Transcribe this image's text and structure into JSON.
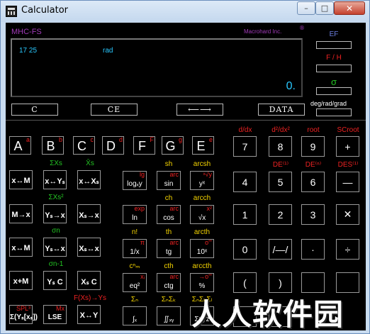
{
  "window": {
    "title": "Calculator",
    "min": "–",
    "max": "□",
    "close": "✕"
  },
  "brand": {
    "model": "MHC-FS",
    "maker": "Macrohard Inc.",
    "reg": "®"
  },
  "display": {
    "digits": "17 25",
    "mode": "rad",
    "value": "0."
  },
  "indicators": [
    {
      "label": "EF",
      "color": "#6b7fe0"
    },
    {
      "label": "F / H",
      "color": "#e22"
    },
    {
      "label": "σ",
      "color": "#23c423"
    }
  ],
  "deg_label": "deg/rad/grad",
  "top_buttons": [
    "C",
    "CE",
    "⟵⟶",
    "DATA"
  ],
  "letters": [
    {
      "main": "A",
      "sup": "a"
    },
    {
      "main": "B",
      "sup": "b"
    },
    {
      "main": "C",
      "sup": "c"
    },
    {
      "main": "D",
      "sup": "d"
    },
    {
      "main": "F",
      "sup": "F"
    },
    {
      "main": "G",
      "sup": "g"
    },
    {
      "main": "E",
      "sup": "e"
    }
  ],
  "stat_keys": [
    [
      {
        "label": "x↔M"
      },
      {
        "label": "x↔Yₛ",
        "above": "ΣXs",
        "above_color": "#23c423"
      },
      {
        "label": "x↔Xₛ",
        "above": "X̄s",
        "above_color": "#23c423"
      }
    ],
    [
      {
        "label": "M→x"
      },
      {
        "label": "Yₛ→x",
        "above": "ΣXs²",
        "above_color": "#23c423"
      },
      {
        "label": "Xₛ→x"
      }
    ],
    [
      {
        "label": "x↔M"
      },
      {
        "label": "Yₛ↔x",
        "above": "σn",
        "above_color": "#23c423"
      },
      {
        "label": "Xₛ↔x"
      }
    ],
    [
      {
        "label": "x+M"
      },
      {
        "label": "Yₛ C",
        "above": "σn-1",
        "above_color": "#23c423"
      },
      {
        "label": "Xₛ C"
      }
    ],
    [
      {
        "label": "Σ(Yₛ[xₛ])",
        "sup": "SPL³"
      },
      {
        "label": "LSE",
        "sup": "Mx"
      },
      {
        "label": "X↔Y",
        "above": "F(Xs)→Ys",
        "above_color": "#e22"
      }
    ]
  ],
  "func_keys": [
    [
      {
        "sup": "lg",
        "small": "logₓy"
      },
      {
        "sup": "arc",
        "small": "sin",
        "above": "sh"
      },
      {
        "sup": "ˣ√y",
        "small": "yˣ",
        "above": "arcsh"
      }
    ],
    [
      {
        "sup": "exp",
        "small": "ln"
      },
      {
        "sup": "arc",
        "small": "cos",
        "above": "ch"
      },
      {
        "sup": "x²",
        "small": "√x",
        "above": "arcch"
      }
    ],
    [
      {
        "sup": "π",
        "small": "1/x",
        "above": "n!"
      },
      {
        "sup": "arc",
        "small": "tg",
        "above": "th"
      },
      {
        "sup": "o'\"",
        "small": "10ˣ",
        "above": "arcth"
      }
    ],
    [
      {
        "sup": "xᵢ",
        "small": "eq²",
        "above": "cⁿₘ"
      },
      {
        "sup": "arc",
        "small": "ctg",
        "above": "cth"
      },
      {
        "sup": "→o'\"",
        "small": "%",
        "above": "arccth"
      }
    ],
    [
      {
        "sup": "",
        "small": "∫ₓ",
        "above": "Σₙ"
      },
      {
        "sup": "",
        "small": "∬ₓᵧ",
        "above": "ΣₙΣₖ"
      },
      {
        "sup": "",
        "small": "Σxyz",
        "above": "ΣₙΣₖΣₗ"
      }
    ]
  ],
  "num_above": [
    [
      "d/dx",
      "d²/dx²",
      "root",
      "SCroot"
    ],
    [
      "",
      "DE⁽¹⁾",
      "DE⁽ⁿ⁾",
      "DES⁽¹⁾"
    ]
  ],
  "num_keys": [
    [
      "7",
      "8",
      "9",
      "+"
    ],
    [
      "4",
      "5",
      "6",
      "—"
    ],
    [
      "1",
      "2",
      "3",
      "✕"
    ],
    [
      "0",
      "/—/",
      "·",
      "÷"
    ],
    [
      "(",
      ")",
      "",
      ""
    ],
    [
      "",
      "",
      "",
      ""
    ]
  ],
  "watermark": "人人软件园"
}
